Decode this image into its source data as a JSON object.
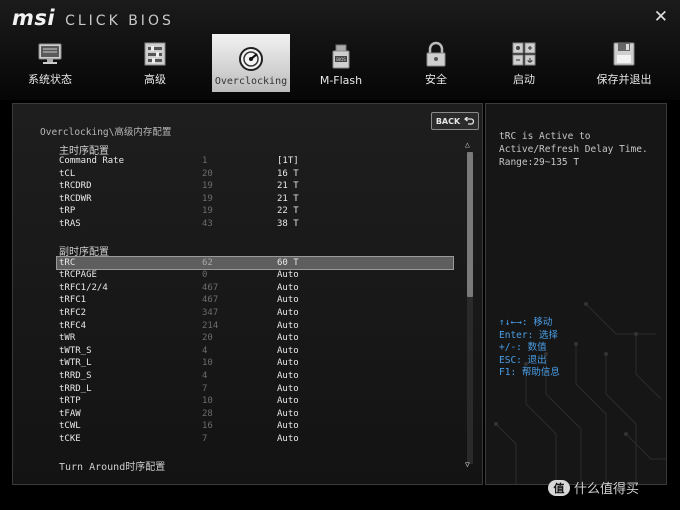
{
  "header": {
    "logo_brand": "msi",
    "logo_product": "CLICK BIOS",
    "close": "✕"
  },
  "tabs": [
    {
      "label": "系统状态",
      "icon": "monitor-icon"
    },
    {
      "label": "高级",
      "icon": "settings-sliders-icon"
    },
    {
      "label": "Overclocking",
      "icon": "speedometer-icon",
      "active": true
    },
    {
      "label": "M-Flash",
      "icon": "flash-drive-icon"
    },
    {
      "label": "安全",
      "icon": "lock-icon"
    },
    {
      "label": "启动",
      "icon": "boot-icon"
    },
    {
      "label": "保存并退出",
      "icon": "floppy-disk-icon"
    }
  ],
  "main": {
    "back_label": "BACK",
    "breadcrumb": "Overclocking\\高级内存配置",
    "primary_title": "主时序配置",
    "primary_rows": [
      {
        "name": "Command Rate",
        "def": "1",
        "val": "[1T]"
      },
      {
        "name": "tCL",
        "def": "20",
        "val": "16 T"
      },
      {
        "name": "tRCDRD",
        "def": "19",
        "val": "21 T"
      },
      {
        "name": "tRCDWR",
        "def": "19",
        "val": "21 T"
      },
      {
        "name": "tRP",
        "def": "19",
        "val": "22 T"
      },
      {
        "name": "tRAS",
        "def": "43",
        "val": "38 T"
      }
    ],
    "secondary_title": "副时序配置",
    "secondary_rows": [
      {
        "name": "tRC",
        "def": "62",
        "val": "60 T",
        "selected": true
      },
      {
        "name": "tRCPAGE",
        "def": "0",
        "val": "Auto"
      },
      {
        "name": "tRFC1/2/4",
        "def": "467",
        "val": "Auto"
      },
      {
        "name": "tRFC1",
        "def": "467",
        "val": "Auto"
      },
      {
        "name": "tRFC2",
        "def": "347",
        "val": "Auto"
      },
      {
        "name": "tRFC4",
        "def": "214",
        "val": "Auto"
      },
      {
        "name": "tWR",
        "def": "20",
        "val": "Auto"
      },
      {
        "name": "tWTR_S",
        "def": "4",
        "val": "Auto"
      },
      {
        "name": "tWTR_L",
        "def": "10",
        "val": "Auto"
      },
      {
        "name": "tRRD_S",
        "def": "4",
        "val": "Auto"
      },
      {
        "name": "tRRD_L",
        "def": "7",
        "val": "Auto"
      },
      {
        "name": "tRTP",
        "def": "10",
        "val": "Auto"
      },
      {
        "name": "tFAW",
        "def": "28",
        "val": "Auto"
      },
      {
        "name": "tCWL",
        "def": "16",
        "val": "Auto"
      },
      {
        "name": "tCKE",
        "def": "7",
        "val": "Auto"
      }
    ],
    "turnaround_title": "Turn Around时序配置"
  },
  "help": {
    "text": "tRC is Active to Active/Refresh Delay Time. Range:29~135 T",
    "keys": [
      "↑↓←→: 移动",
      "Enter: 选择",
      "+/-: 数值",
      "ESC: 退出",
      "F1: 帮助信息"
    ]
  },
  "watermark": {
    "badge": "值",
    "text": "什么值得买"
  },
  "colors": {
    "accent_blue": "#4a9fe8",
    "selected_row": "#5e5e5e",
    "active_tab": "#e0e0e0"
  }
}
